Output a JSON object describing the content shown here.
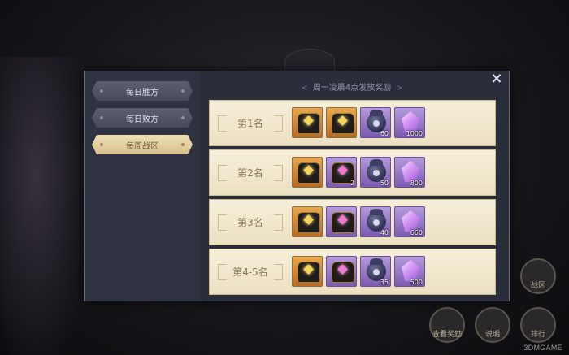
{
  "header": {
    "note": "周一凌晨4点发放奖励",
    "arrow_left": "<",
    "arrow_right": ">"
  },
  "tabs": [
    {
      "label": "每日胜方",
      "active": false
    },
    {
      "label": "每日败方",
      "active": false
    },
    {
      "label": "每周战区",
      "active": true
    }
  ],
  "close_icon": "×",
  "rewards": [
    {
      "rank": "第1名",
      "items": [
        {
          "icon": "gold-chest-icon",
          "count": ""
        },
        {
          "icon": "gold-chest-icon",
          "count": ""
        },
        {
          "icon": "ghost-bag-icon",
          "count": "60"
        },
        {
          "icon": "crystal-icon",
          "count": "1000"
        }
      ]
    },
    {
      "rank": "第2名",
      "items": [
        {
          "icon": "gold-chest-icon",
          "count": ""
        },
        {
          "icon": "pink-chest-icon",
          "count": "2"
        },
        {
          "icon": "ghost-bag-icon",
          "count": "50"
        },
        {
          "icon": "crystal-icon",
          "count": "800"
        }
      ]
    },
    {
      "rank": "第3名",
      "items": [
        {
          "icon": "gold-chest-icon",
          "count": ""
        },
        {
          "icon": "pink-chest-icon",
          "count": ""
        },
        {
          "icon": "ghost-bag-icon",
          "count": "40"
        },
        {
          "icon": "crystal-icon",
          "count": "660"
        }
      ]
    },
    {
      "rank": "第4-5名",
      "items": [
        {
          "icon": "gold-chest-icon",
          "count": ""
        },
        {
          "icon": "pink-chest-icon",
          "count": ""
        },
        {
          "icon": "ghost-bag-icon",
          "count": "35"
        },
        {
          "icon": "crystal-icon",
          "count": "500"
        }
      ]
    }
  ],
  "side_buttons": {
    "battle": "战区",
    "rewards": "查看奖励",
    "rules": "说明",
    "ranking": "排行"
  },
  "watermark": "3DMGAME",
  "colors": {
    "tab_active": "#efe0b6",
    "tab_inactive": "#5a5e70",
    "panel": "#2f3240",
    "row": "#f6efd9"
  }
}
